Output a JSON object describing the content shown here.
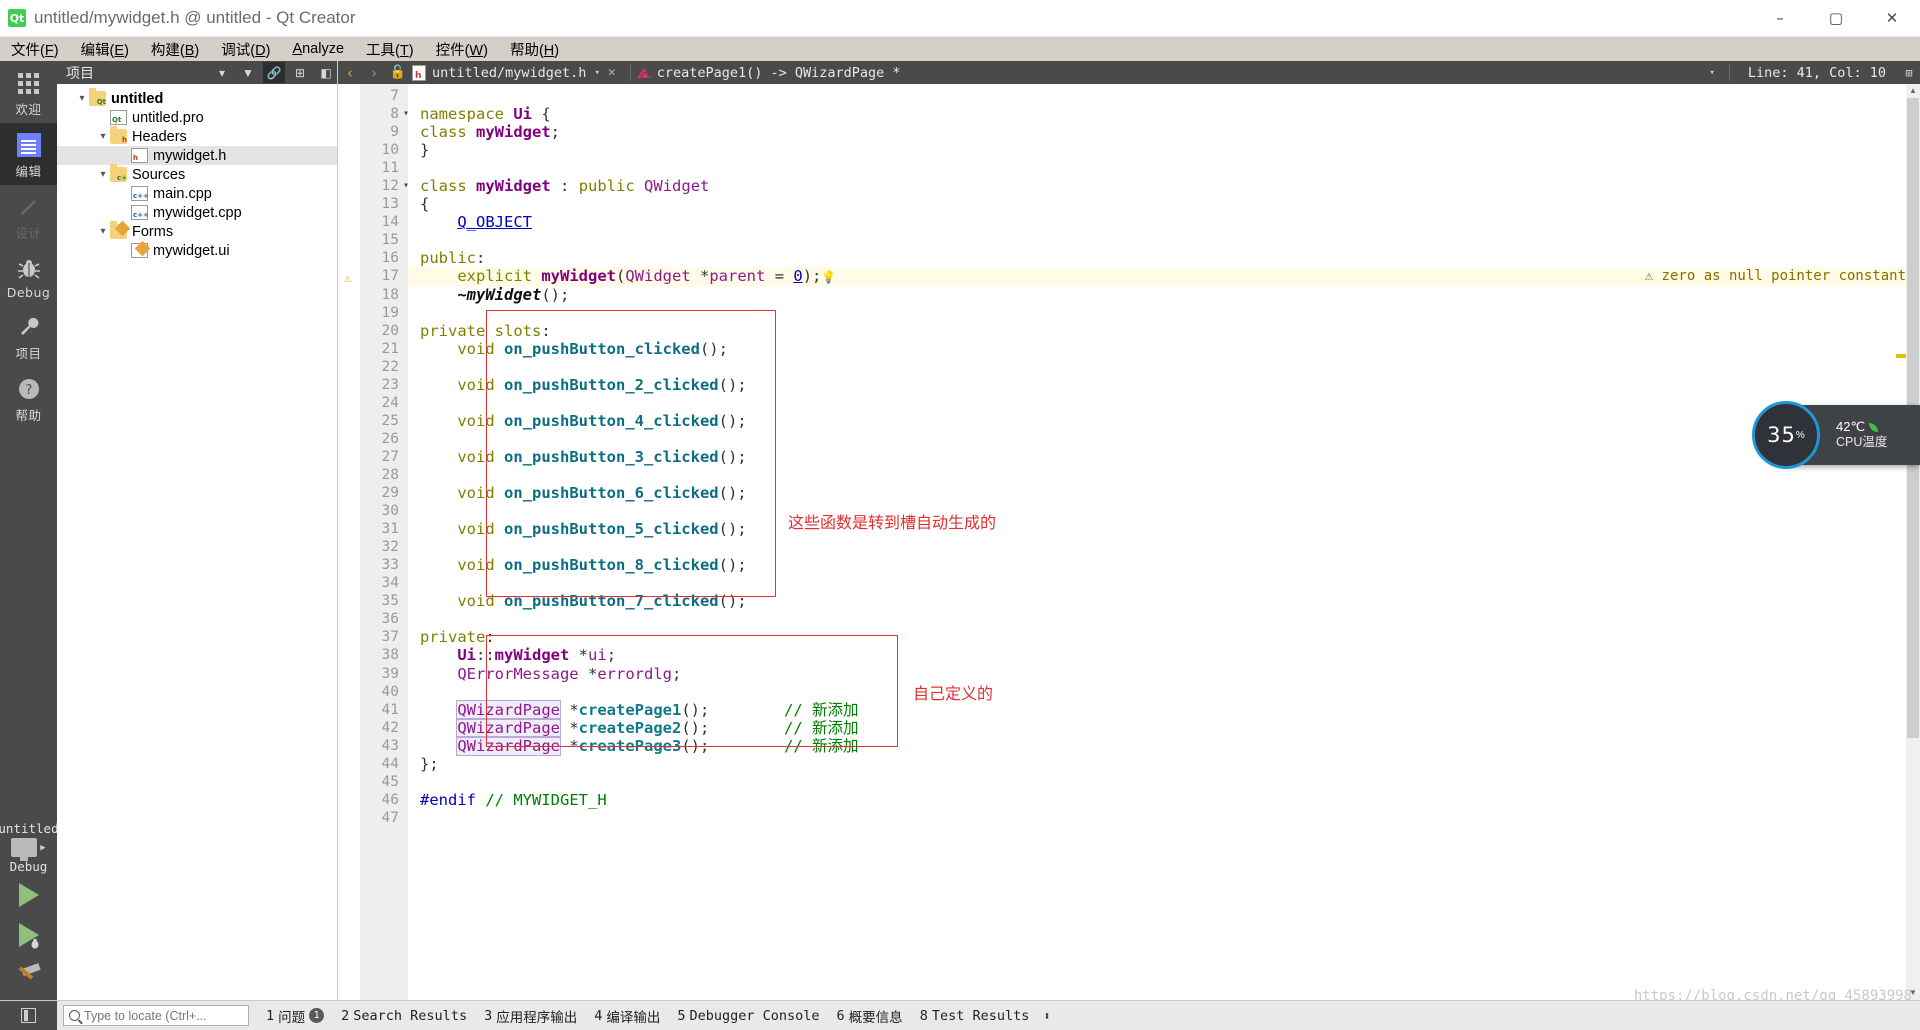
{
  "window": {
    "title": "untitled/mywidget.h @ untitled - Qt Creator",
    "app_icon": "qt-logo-icon",
    "minimize": "–",
    "maximize": "▢",
    "close": "✕"
  },
  "menubar": [
    {
      "label": "文件(F)",
      "mnemonic": "F"
    },
    {
      "label": "编辑(E)",
      "mnemonic": "E"
    },
    {
      "label": "构建(B)",
      "mnemonic": "B"
    },
    {
      "label": "调试(D)",
      "mnemonic": "D"
    },
    {
      "label": "Analyze",
      "mnemonic": "A"
    },
    {
      "label": "工具(T)",
      "mnemonic": "T"
    },
    {
      "label": "控件(W)",
      "mnemonic": "W"
    },
    {
      "label": "帮助(H)",
      "mnemonic": "H"
    }
  ],
  "modebar": {
    "items": [
      {
        "label": "欢迎",
        "icon": "grid-icon",
        "state": "normal"
      },
      {
        "label": "编辑",
        "icon": "document-lines-icon",
        "state": "active"
      },
      {
        "label": "设计",
        "icon": "pencil-icon",
        "state": "disabled"
      },
      {
        "label": "Debug",
        "icon": "bug-icon",
        "state": "normal"
      },
      {
        "label": "项目",
        "icon": "wrench-icon",
        "state": "normal"
      },
      {
        "label": "帮助",
        "icon": "question-circle-icon",
        "state": "normal"
      }
    ],
    "kit": {
      "project": "untitled",
      "buildconfig": "Debug",
      "target_icon": "monitor-icon",
      "run_label": "run-button",
      "debug_label": "start-debugging-button",
      "build_label": "build-button"
    }
  },
  "project_pane": {
    "title": "项目",
    "header_icons": [
      "filter-icon",
      "link-icon",
      "expand-all-icon",
      "collapse-icon"
    ],
    "tree": [
      {
        "label": "untitled",
        "depth": 0,
        "icon": "qt-project-folder-icon",
        "arrow": "▾",
        "bold": true,
        "selected": false
      },
      {
        "label": "untitled.pro",
        "depth": 1,
        "icon": "qt-pro-file-icon",
        "arrow": "",
        "bold": false,
        "selected": false
      },
      {
        "label": "Headers",
        "depth": 1,
        "icon": "headers-folder-icon",
        "arrow": "▾",
        "bold": false,
        "selected": false
      },
      {
        "label": "mywidget.h",
        "depth": 2,
        "icon": "header-file-icon",
        "arrow": "",
        "bold": false,
        "selected": true
      },
      {
        "label": "Sources",
        "depth": 1,
        "icon": "sources-folder-icon",
        "arrow": "▾",
        "bold": false,
        "selected": false
      },
      {
        "label": "main.cpp",
        "depth": 2,
        "icon": "cpp-file-icon",
        "arrow": "",
        "bold": false,
        "selected": false
      },
      {
        "label": "mywidget.cpp",
        "depth": 2,
        "icon": "cpp-file-icon",
        "arrow": "",
        "bold": false,
        "selected": false
      },
      {
        "label": "Forms",
        "depth": 1,
        "icon": "forms-folder-icon",
        "arrow": "▾",
        "bold": false,
        "selected": false
      },
      {
        "label": "mywidget.ui",
        "depth": 2,
        "icon": "ui-file-icon",
        "arrow": "",
        "bold": false,
        "selected": false
      }
    ]
  },
  "editor_toolbar": {
    "back": "‹",
    "forward": "›",
    "lock": "unlocked-icon",
    "filename": "untitled/mywidget.h",
    "file_dropdown": "▾",
    "close": "✕",
    "symbol": "createPage1() -> QWizardPage *",
    "symbol_dropdown": "▾",
    "linecol": "Line: 41, Col: 10",
    "split": "split-editor-icon"
  },
  "editor": {
    "first_line": 7,
    "last_line": 47,
    "warning_line": 17,
    "warning_text": "zero as null pointer constant",
    "lines": [
      {
        "n": 7,
        "fold": "",
        "html": ""
      },
      {
        "n": 8,
        "fold": "▾",
        "html": "<span class='kw'>namespace</span> <span class='typ'>Ui</span> <span class='pun'>{</span>"
      },
      {
        "n": 9,
        "fold": "",
        "html": "<span class='kw'>class</span> <span class='typ'>myWidget</span><span class='pun'>;</span>"
      },
      {
        "n": 10,
        "fold": "",
        "html": "<span class='pun'>}</span>"
      },
      {
        "n": 11,
        "fold": "",
        "html": ""
      },
      {
        "n": 12,
        "fold": "▾",
        "html": "<span class='kw'>class</span> <span class='typ'>myWidget</span> <span class='pun'>:</span> <span class='kw'>public</span> <span class='cls'>QWidget</span>"
      },
      {
        "n": 13,
        "fold": "",
        "html": "<span class='pun'>{</span>"
      },
      {
        "n": 14,
        "fold": "",
        "html": "    <span class='macro'>Q_OBJECT</span>"
      },
      {
        "n": 15,
        "fold": "",
        "html": ""
      },
      {
        "n": 16,
        "fold": "",
        "html": "<span class='kw'>public</span><span class='pun'>:</span>"
      },
      {
        "n": 17,
        "fold": "",
        "html": "    <span class='kw'>explicit</span> <span class='typ'>myWidget</span><span class='pun'>(</span><span class='cls'>QWidget</span> <span class='pun'>*</span><span class='cls'>parent</span> <span class='pun'>=</span> <span class='num'>0</span><span class='pun'>);</span><span class='bulb'>💡</span>"
      },
      {
        "n": 18,
        "fold": "",
        "html": "    <span class='dtor'>~myWidget</span><span class='pun'>();</span>"
      },
      {
        "n": 19,
        "fold": "",
        "html": ""
      },
      {
        "n": 20,
        "fold": "",
        "html": "<span class='kw'>private slots</span><span class='pun'>:</span>"
      },
      {
        "n": 21,
        "fold": "",
        "html": "    <span class='kw'>void</span> <span class='fn'>on_pushButton_clicked</span><span class='pun'>();</span>"
      },
      {
        "n": 22,
        "fold": "",
        "html": ""
      },
      {
        "n": 23,
        "fold": "",
        "html": "    <span class='kw'>void</span> <span class='fn'>on_pushButton_2_clicked</span><span class='pun'>();</span>"
      },
      {
        "n": 24,
        "fold": "",
        "html": ""
      },
      {
        "n": 25,
        "fold": "",
        "html": "    <span class='kw'>void</span> <span class='fn'>on_pushButton_4_clicked</span><span class='pun'>();</span>"
      },
      {
        "n": 26,
        "fold": "",
        "html": ""
      },
      {
        "n": 27,
        "fold": "",
        "html": "    <span class='kw'>void</span> <span class='fn'>on_pushButton_3_clicked</span><span class='pun'>();</span>"
      },
      {
        "n": 28,
        "fold": "",
        "html": ""
      },
      {
        "n": 29,
        "fold": "",
        "html": "    <span class='kw'>void</span> <span class='fn'>on_pushButton_6_clicked</span><span class='pun'>();</span>"
      },
      {
        "n": 30,
        "fold": "",
        "html": ""
      },
      {
        "n": 31,
        "fold": "",
        "html": "    <span class='kw'>void</span> <span class='fn'>on_pushButton_5_clicked</span><span class='pun'>();</span>"
      },
      {
        "n": 32,
        "fold": "",
        "html": ""
      },
      {
        "n": 33,
        "fold": "",
        "html": "    <span class='kw'>void</span> <span class='fn'>on_pushButton_8_clicked</span><span class='pun'>();</span>"
      },
      {
        "n": 34,
        "fold": "",
        "html": ""
      },
      {
        "n": 35,
        "fold": "",
        "html": "    <span class='kw'>void</span> <span class='fn'>on_pushButton_7_clicked</span><span class='pun'>();</span>"
      },
      {
        "n": 36,
        "fold": "",
        "html": ""
      },
      {
        "n": 37,
        "fold": "",
        "html": "<span class='kw'>private</span><span class='pun'>:</span>"
      },
      {
        "n": 38,
        "fold": "",
        "html": "    <span class='typ'>Ui</span><span class='pun'>::</span><span class='typ'>myWidget</span> <span class='pun'>*</span><span class='cls'>ui</span><span class='pun'>;</span>"
      },
      {
        "n": 39,
        "fold": "",
        "html": "    <span class='cls'>QErrorMessage</span> <span class='pun'>*</span><span class='cls'>errordlg</span><span class='pun'>;</span>"
      },
      {
        "n": 40,
        "fold": "",
        "html": ""
      },
      {
        "n": 41,
        "fold": "",
        "html": "    <span class='occ cls'>QWizardPage</span> <span class='pun'>*</span><span class='fn2'>createPage1</span><span class='pun'>();</span>        <span class='cmt'>// 新添加</span>"
      },
      {
        "n": 42,
        "fold": "",
        "html": "    <span class='occ cls'>QWizardPage</span> <span class='pun'>*</span><span class='fn2'>createPage2</span><span class='pun'>();</span>        <span class='cmt'>// 新添加</span>"
      },
      {
        "n": 43,
        "fold": "",
        "html": "    <span class='occ cls'>QWizardPage</span> <span class='pun'>*</span><span class='fn2'>createPage3</span><span class='pun'>();</span>        <span class='cmt'>// 新添加</span>"
      },
      {
        "n": 44,
        "fold": "",
        "html": "<span class='pun'>};</span>"
      },
      {
        "n": 45,
        "fold": "",
        "html": ""
      },
      {
        "n": 46,
        "fold": "",
        "html": "<span class='macro' style='text-decoration:none;color:#0000c0'>#endif</span> <span class='cmt'>// MYWIDGET_H</span>"
      },
      {
        "n": 47,
        "fold": "",
        "html": ""
      }
    ],
    "annotations": [
      {
        "text": "这些函数是转到槽自动生成的",
        "color": "#e03030"
      },
      {
        "text": "自己定义的",
        "color": "#e03030"
      }
    ]
  },
  "cpu_widget": {
    "percent": "35",
    "percent_symbol": "%",
    "temperature": "42℃",
    "label": "CPU温度",
    "ring_color": "#2196d6",
    "leaf_color": "#3ec13e"
  },
  "statusbar": {
    "sidebar_toggle": "toggle-sidebar-icon",
    "search_placeholder": "Type to locate (Ctrl+...",
    "search_value": "",
    "items": [
      {
        "num": "1",
        "label": "问题",
        "badge": "1"
      },
      {
        "num": "2",
        "label": "Search Results",
        "badge": ""
      },
      {
        "num": "3",
        "label": "应用程序输出",
        "badge": ""
      },
      {
        "num": "4",
        "label": "编译输出",
        "badge": ""
      },
      {
        "num": "5",
        "label": "Debugger Console",
        "badge": ""
      },
      {
        "num": "6",
        "label": "概要信息",
        "badge": ""
      },
      {
        "num": "8",
        "label": "Test Results",
        "badge": ""
      }
    ],
    "updown": "⬍"
  },
  "watermark": "https://blog.csdn.net/qq_45893998"
}
